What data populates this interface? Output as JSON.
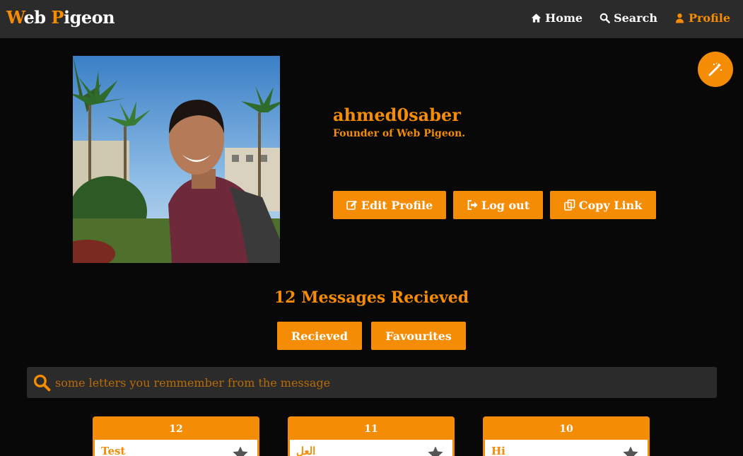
{
  "colors": {
    "accent": "#f48c06",
    "navbar_bg": "#2b2b2b",
    "page_bg": "#080808",
    "text_light": "#ffffff"
  },
  "brand": {
    "first_initial": "W",
    "first_rest": "eb",
    "second_initial": "P",
    "second_rest": "igeon"
  },
  "nav": {
    "items": [
      {
        "label": "Home",
        "icon": "home-icon",
        "active": false
      },
      {
        "label": "Search",
        "icon": "search-icon",
        "active": false
      },
      {
        "label": "Profile",
        "icon": "user-icon",
        "active": true
      }
    ]
  },
  "fab": {
    "icon": "magic-wand-icon"
  },
  "profile": {
    "photo_icon": "profile-photo",
    "username": "ahmed0saber",
    "bio": "Founder of Web Pigeon.",
    "edit_label": "Edit Profile",
    "logout_label": "Log out",
    "copy_label": "Copy Link"
  },
  "messages": {
    "count_text": "12 Messages Recieved",
    "tabs": {
      "recieved": "Recieved",
      "favourites": "Favourites"
    },
    "search_placeholder": "some letters you remmember from the message",
    "cards": [
      {
        "number": "12",
        "title": "Test"
      },
      {
        "number": "11",
        "title": "العل"
      },
      {
        "number": "10",
        "title": "Hi"
      }
    ]
  }
}
